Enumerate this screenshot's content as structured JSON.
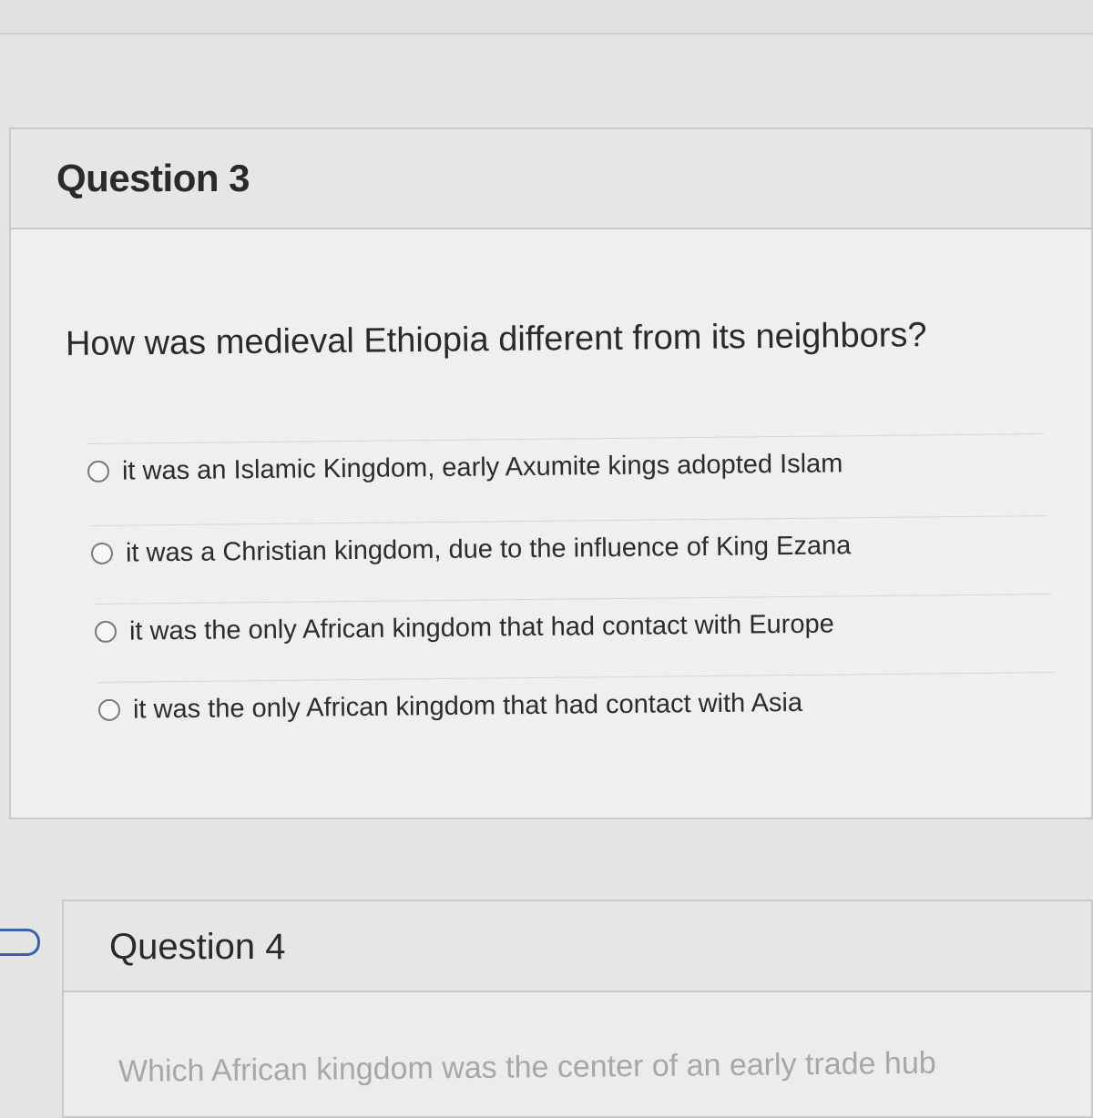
{
  "question3": {
    "title": "Question 3",
    "prompt": "How was medieval Ethiopia different from its neighbors?",
    "answers": [
      {
        "label": "it was an Islamic Kingdom, early Axumite kings adopted Islam",
        "selected": false
      },
      {
        "label": "it was a Christian kingdom, due to the influence of King Ezana",
        "selected": false
      },
      {
        "label": "it was the only African kingdom that had contact with Europe",
        "selected": false
      },
      {
        "label": "it was the only African kingdom that had contact with Asia",
        "selected": false
      }
    ]
  },
  "question4": {
    "title": "Question 4",
    "prompt": "Which African kingdom was the center of an early trade hub"
  }
}
